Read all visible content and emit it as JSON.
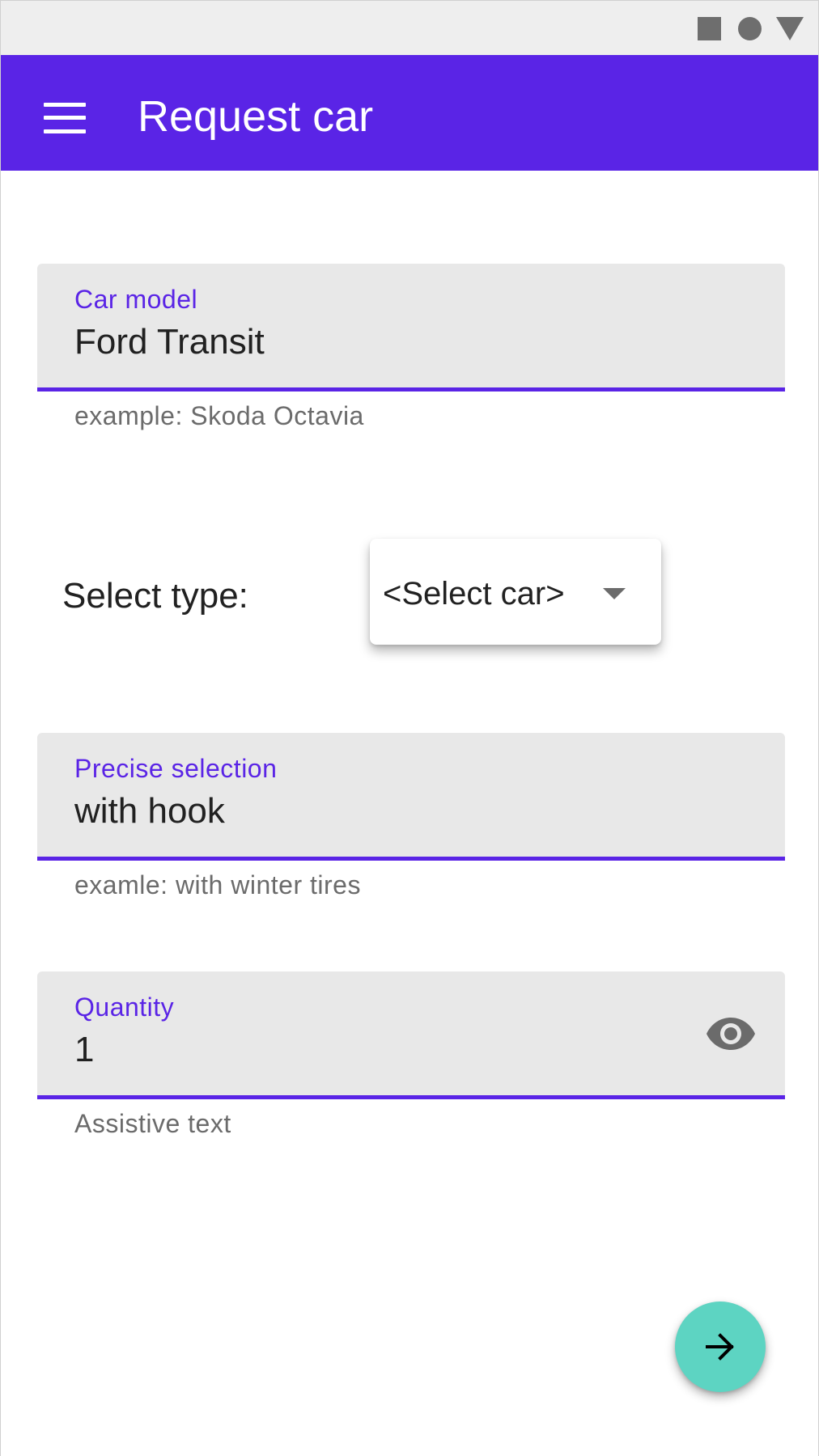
{
  "status_bar": {
    "icons": [
      "square-icon",
      "circle-icon",
      "triangle-icon"
    ]
  },
  "app_bar": {
    "title": "Request car",
    "menu_icon": "menu-icon",
    "color": "#5a24e6"
  },
  "car_model": {
    "label": "Car model",
    "value": "Ford Transit",
    "helper": "example: Skoda Octavia"
  },
  "type_select": {
    "label": "Select type:",
    "value": "<Select car>",
    "icon": "chevron-down-icon"
  },
  "precise_selection": {
    "label": "Precise selection",
    "value": "with hook",
    "helper": "examle: with winter tires"
  },
  "quantity": {
    "label": "Quantity",
    "value": "1",
    "helper": "Assistive text",
    "icon": "eye-icon"
  },
  "fab": {
    "icon": "arrow-right-icon",
    "color": "#5dd4c2"
  }
}
